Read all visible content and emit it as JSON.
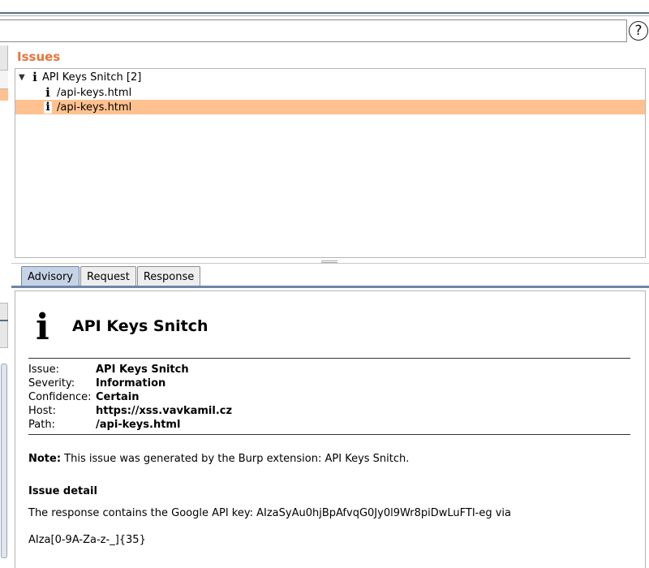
{
  "toolbar": {
    "filter_value": "",
    "help_label": "?"
  },
  "issues": {
    "title": "Issues",
    "group_label": "API Keys Snitch [2]",
    "items": [
      {
        "label": "/api-keys.html",
        "selected": false
      },
      {
        "label": "/api-keys.html",
        "selected": true
      }
    ]
  },
  "tabs": [
    {
      "label": "Advisory",
      "active": true
    },
    {
      "label": "Request",
      "active": false
    },
    {
      "label": "Response",
      "active": false
    }
  ],
  "advisory": {
    "heading": "API Keys Snitch",
    "fields": [
      {
        "key": "Issue:",
        "value": "API Keys Snitch"
      },
      {
        "key": "Severity:",
        "value": "Information"
      },
      {
        "key": "Confidence:",
        "value": "Certain"
      },
      {
        "key": "Host:",
        "value": "https://xss.vavkamil.cz"
      },
      {
        "key": "Path:",
        "value": "/api-keys.html"
      }
    ],
    "note_label": "Note:",
    "note_text": " This issue was generated by the Burp extension: API Keys Snitch.",
    "detail_heading": "Issue detail",
    "detail_text": "The response contains the Google API key: AIzaSyAu0hjBpAfvqG0Jy0l9Wr8piDwLuFTI-eg via",
    "regex_text": "AIza[0-9A-Za-z-_]{35}"
  },
  "icons": {
    "info": "i",
    "expand": "▼"
  },
  "colors": {
    "accent": "#e8743b",
    "selection": "#ffc18f",
    "active_tab": "#c6d3e6"
  }
}
